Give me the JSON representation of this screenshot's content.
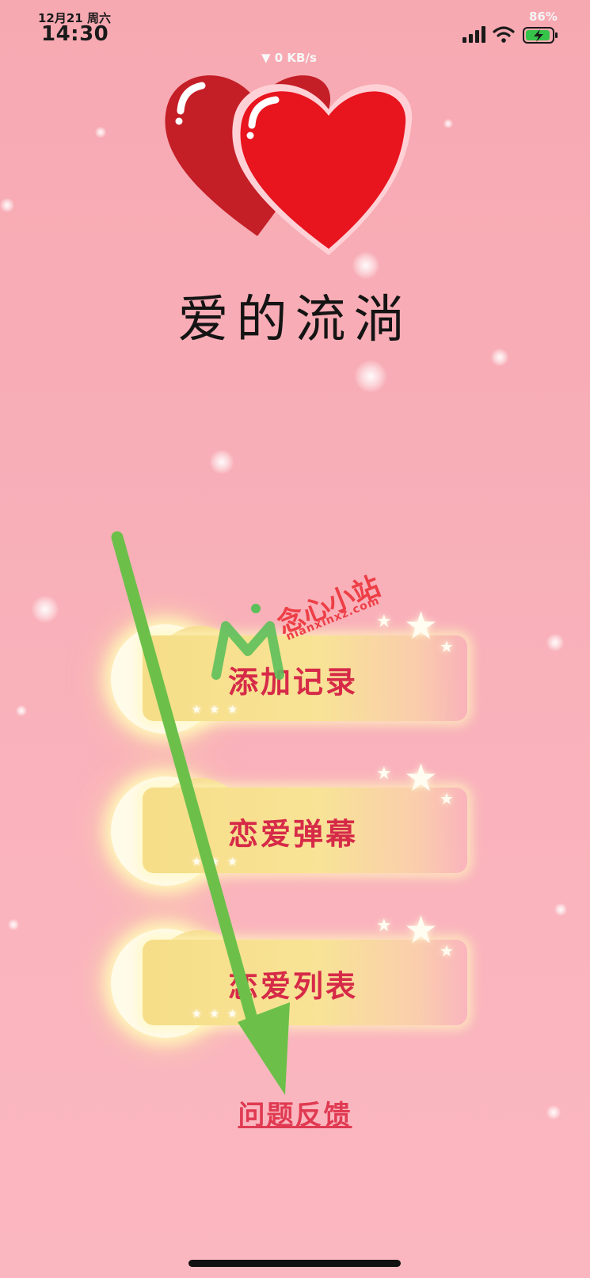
{
  "status_bar": {
    "date": "12月21 周六",
    "time": "14:30",
    "battery_percent": "86%",
    "network_speed": "▼ 0 KB/s",
    "icons": [
      "signal-icon",
      "wifi-icon",
      "battery-charging-icon"
    ]
  },
  "app": {
    "title": "爱的流淌",
    "logo": "double-heart-icon"
  },
  "menu": [
    {
      "label": "添加记录"
    },
    {
      "label": "恋爱弹幕"
    },
    {
      "label": "恋爱列表"
    }
  ],
  "feedback_link": "问题反馈",
  "watermark": {
    "text": "念心小站",
    "subtext": "nianxinxz.com"
  },
  "colors": {
    "background": "#f8aeb7",
    "title": "#141414",
    "menu_label": "#d62a48",
    "feedback": "#e03a52",
    "arrow": "#6cc04a",
    "heart_back": "#c41e27",
    "heart_front": "#e8141e"
  }
}
